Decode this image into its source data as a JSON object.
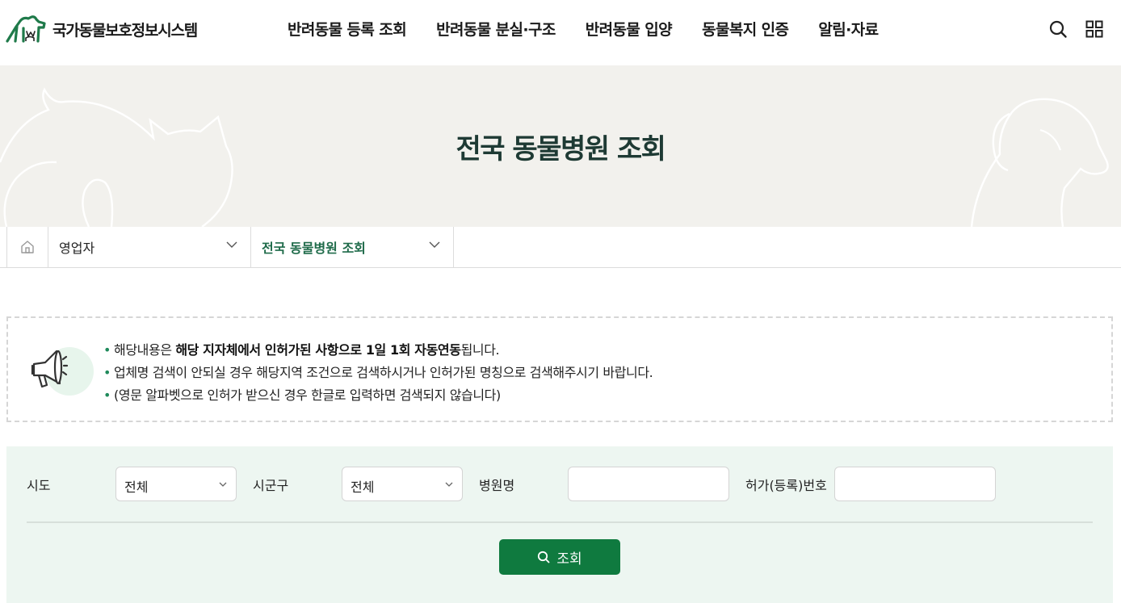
{
  "header": {
    "logo_text": "국가동물보호정보시스템",
    "nav": [
      {
        "label": "반려동물 등록 조회"
      },
      {
        "label": "반려동물 분실·구조"
      },
      {
        "label": "반려동물 입양"
      },
      {
        "label": "동물복지 인증"
      },
      {
        "label": "알림·자료"
      }
    ],
    "search_icon": "search-icon",
    "menu_icon": "grid-menu-icon"
  },
  "banner": {
    "title": "전국 동물병원 조회"
  },
  "breadcrumb": {
    "home_icon": "home-icon",
    "level1": "영업자",
    "level2": "전국 동물병원 조회"
  },
  "notice": {
    "icon": "megaphone-icon",
    "line1_pre": "해당내용은 ",
    "line1_bold": "해당 지자체에서 인허가된 사항으로 1일 1회 자동연동",
    "line1_post": "됩니다.",
    "line2": "업체명 검색이 안되실 경우 해당지역 조건으로 검색하시거나 인허가된 명칭으로 검색해주시기 바랍니다.",
    "line3": "(영문 알파벳으로 인허가 받으신 경우 한글로 입력하면 검색되지 않습니다)"
  },
  "search": {
    "sido_label": "시도",
    "sido_value": "전체",
    "sigungu_label": "시군구",
    "sigungu_value": "전체",
    "hospital_label": "병원명",
    "hospital_value": "",
    "license_label": "허가(등록)번호",
    "license_value": "",
    "submit_label": "조회"
  },
  "colors": {
    "brand_green": "#0f7a3f",
    "title_dark": "#1e3a34",
    "banner_bg": "#f2f1ed",
    "search_bg": "#edf6f1"
  }
}
